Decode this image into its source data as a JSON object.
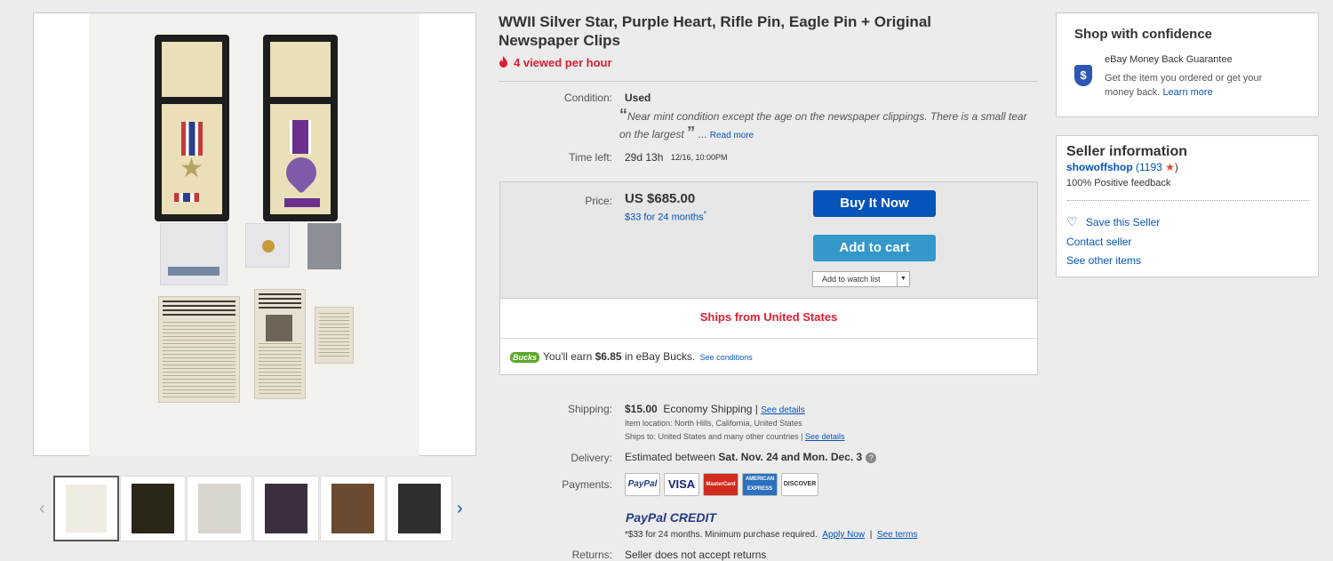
{
  "listing": {
    "title": "WWII Silver Star, Purple Heart, Rifle Pin, Eagle Pin + Original Newspaper Clips",
    "viewed": "4 viewed per hour"
  },
  "condition": {
    "label": "Condition:",
    "value": "Used",
    "quote": "Near mint condition except the age on the newspaper clippings. There is a small tear on the largest",
    "read_more": "Read more"
  },
  "time_left": {
    "label": "Time left:",
    "value": "29d 13h",
    "end": "12/16, 10:00PM"
  },
  "price": {
    "label": "Price:",
    "value": "US $685.00",
    "monthly": "$33 for 24 months",
    "asterisk": "*"
  },
  "buttons": {
    "buy_now": "Buy It Now",
    "add_to_cart": "Add to cart",
    "watch": "Add to watch list"
  },
  "ships_from": "Ships from United States",
  "bucks": {
    "logo": "Bucks",
    "text_pre": "You'll earn ",
    "amount": "$6.85",
    "text_post": " in eBay Bucks.",
    "link": "See conditions"
  },
  "shipping": {
    "label": "Shipping:",
    "cost": "$15.00",
    "method": "Economy Shipping",
    "sep": " | ",
    "details": "See details",
    "location": "Item location:  North Hills, California, United States",
    "ships_to": "Ships to:  United States and many other countries",
    "ships_to_details": "See details"
  },
  "delivery": {
    "label": "Delivery:",
    "pre": "Estimated between ",
    "dates": "Sat. Nov. 24 and Mon. Dec. 3",
    "help": "?"
  },
  "payments": {
    "label": "Payments:",
    "methods": [
      "PayPal",
      "VISA",
      "MasterCard",
      "AMERICAN EXPRESS",
      "DISCOVER"
    ],
    "credit_logo": "PayPal CREDIT",
    "credit_note": "*$33 for 24 months. Minimum purchase required.",
    "apply": "Apply Now",
    "terms": "See terms",
    "returns_label": "Returns:",
    "returns_value": "Seller does not accept returns"
  },
  "confidence": {
    "title": "Shop with confidence",
    "guarantee": "eBay Money Back Guarantee",
    "desc": "Get the item you ordered or get your money back.",
    "learn": "Learn more"
  },
  "seller": {
    "title": "Seller information",
    "name": "showoffshop",
    "feedback_count": "(1193",
    "feedback_close": ")",
    "positive": "100% Positive feedback",
    "save": "Save this Seller",
    "contact": "Contact seller",
    "other": "See other items"
  },
  "colors": {
    "link": "#0654ba",
    "alert": "#dd1e31",
    "buy": "#0654ba",
    "cart": "#3498ca"
  }
}
